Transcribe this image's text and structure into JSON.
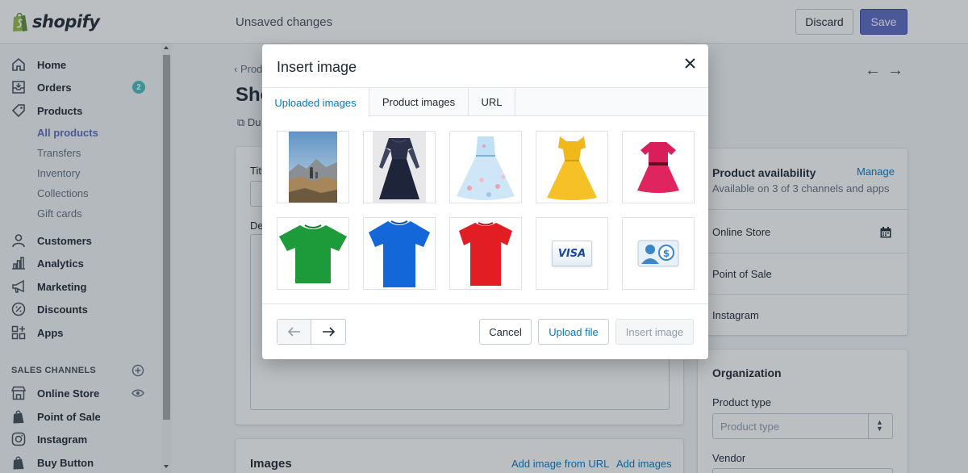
{
  "brand": {
    "name": "shopify",
    "accent": "#5c6ac4",
    "badge_color": "#47c1bf",
    "link_color": "#007ace"
  },
  "topbar": {
    "status": "Unsaved changes",
    "discard_label": "Discard",
    "save_label": "Save"
  },
  "sidebar": {
    "items": [
      {
        "label": "Home",
        "icon": "home-icon"
      },
      {
        "label": "Orders",
        "icon": "orders-icon",
        "badge": "2"
      },
      {
        "label": "Products",
        "icon": "tag-icon"
      },
      {
        "label": "Customers",
        "icon": "person-icon"
      },
      {
        "label": "Analytics",
        "icon": "bar-chart-icon"
      },
      {
        "label": "Marketing",
        "icon": "megaphone-icon"
      },
      {
        "label": "Discounts",
        "icon": "discount-icon"
      },
      {
        "label": "Apps",
        "icon": "apps-icon"
      }
    ],
    "product_subitems": [
      "All products",
      "Transfers",
      "Inventory",
      "Collections",
      "Gift cards"
    ],
    "sales_channels_heading": "SALES CHANNELS",
    "channels": [
      {
        "label": "Online Store",
        "icon": "store-icon"
      },
      {
        "label": "Point of Sale",
        "icon": "pos-icon"
      },
      {
        "label": "Instagram",
        "icon": "instagram-icon"
      },
      {
        "label": "Buy Button",
        "icon": "buy-button-icon"
      }
    ]
  },
  "background": {
    "breadcrumb": "Prod",
    "page_title": "Sho",
    "duplicate_label": "Du",
    "title_label": "Titl",
    "description_label": "De",
    "images_heading": "Images",
    "add_image_url": "Add image from URL",
    "add_images": "Add images",
    "availability": {
      "title": "Product availability",
      "manage": "Manage",
      "subtitle": "Available on 3 of 3 channels and apps",
      "channels": [
        "Online Store",
        "Point of Sale",
        "Instagram"
      ]
    },
    "organization": {
      "title": "Organization",
      "product_type_label": "Product type",
      "product_type_placeholder": "Product type",
      "vendor_label": "Vendor"
    }
  },
  "modal": {
    "title": "Insert image",
    "tabs": [
      "Uploaded images",
      "Product images",
      "URL"
    ],
    "active_tab": "Uploaded images",
    "images": [
      "mountain-photo",
      "navy-lace-dress",
      "floral-blue-dress",
      "yellow-dress",
      "pink-dress",
      "green-tshirt",
      "blue-tshirt",
      "red-tshirt",
      "visa-card",
      "payment-user-icon"
    ],
    "visa_text": "VISA",
    "cancel_label": "Cancel",
    "upload_label": "Upload file",
    "insert_label": "Insert image"
  }
}
